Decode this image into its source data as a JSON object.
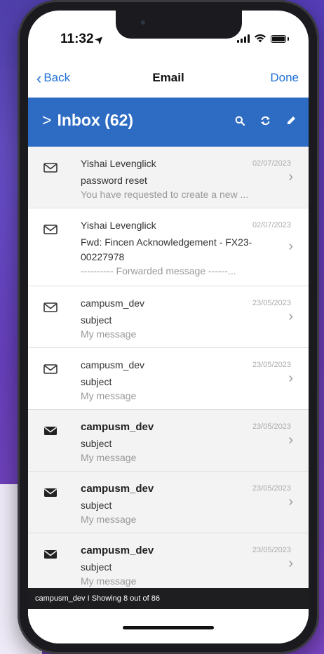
{
  "status": {
    "time": "11:32"
  },
  "nav": {
    "back_label": "Back",
    "title": "Email",
    "done_label": "Done"
  },
  "header": {
    "title": "Inbox (62)",
    "accent_color": "#2e6cc4"
  },
  "emails": [
    {
      "sender": "Yishai Levenglick",
      "date": "02/07/2023",
      "subject": "password reset",
      "preview": "You have requested to create a new ...",
      "unread": false
    },
    {
      "sender": "Yishai Levenglick",
      "date": "02/07/2023",
      "subject": "Fwd: Fincen Acknowledgement - FX23-00227978",
      "preview": "---------- Forwarded message ------...",
      "unread": false
    },
    {
      "sender": "campusm_dev",
      "date": "23/05/2023",
      "subject": "subject",
      "preview": "My message",
      "unread": false
    },
    {
      "sender": "campusm_dev",
      "date": "23/05/2023",
      "subject": "subject",
      "preview": "My message",
      "unread": false
    },
    {
      "sender": "campusm_dev",
      "date": "23/05/2023",
      "subject": "subject",
      "preview": "My message",
      "unread": true
    },
    {
      "sender": "campusm_dev",
      "date": "23/05/2023",
      "subject": "subject",
      "preview": "My message",
      "unread": true
    },
    {
      "sender": "campusm_dev",
      "date": "23/05/2023",
      "subject": "subject",
      "preview": "My message",
      "unread": true
    }
  ],
  "footer": {
    "text": "campusm_dev I Showing 8 out of 86"
  }
}
